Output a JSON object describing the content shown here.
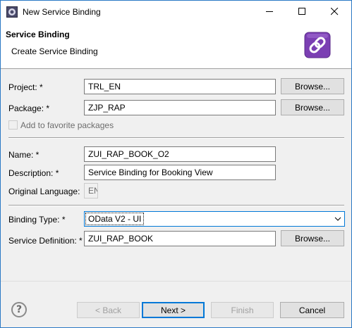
{
  "window": {
    "title": "New Service Binding"
  },
  "header": {
    "title": "Service Binding",
    "subtitle": "Create Service Binding",
    "icon": "service-binding-wizard-icon"
  },
  "form": {
    "project": {
      "label": "Project: *",
      "mnemonic": "P",
      "value": "TRL_EN",
      "browse": "Browse..."
    },
    "package": {
      "label": "Package: *",
      "mnemonic": "a",
      "value": "ZJP_RAP",
      "browse": "Browse..."
    },
    "favorite": {
      "label": "Add to favorite packages",
      "checked": false,
      "enabled": false
    },
    "name": {
      "label": "Name: *",
      "value": "ZUI_RAP_BOOK_O2"
    },
    "description": {
      "label": "Description: *",
      "value": "Service Binding for Booking View"
    },
    "original_language": {
      "label": "Original Language:",
      "value": "EN"
    },
    "binding_type": {
      "label": "Binding Type: *",
      "value": "OData V2 - UI"
    },
    "service_definition": {
      "label": "Service Definition: *",
      "value": "ZUI_RAP_BOOK",
      "browse": "Browse..."
    }
  },
  "footer": {
    "back": "< Back",
    "next": "Next >",
    "finish": "Finish",
    "cancel": "Cancel"
  },
  "colors": {
    "accent": "#0078d7",
    "wizard_icon": "#7b3fb3"
  }
}
